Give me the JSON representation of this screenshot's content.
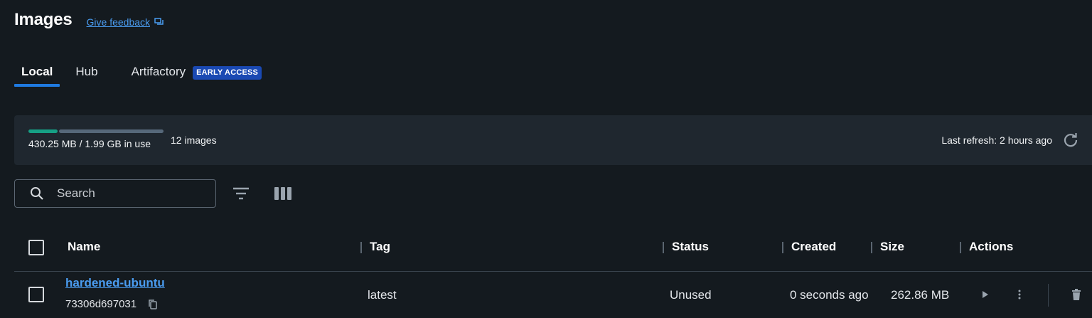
{
  "header": {
    "title": "Images",
    "feedback_label": "Give feedback"
  },
  "tabs": [
    {
      "label": "Local",
      "active": true
    },
    {
      "label": "Hub",
      "active": false
    },
    {
      "label": "Artifactory",
      "active": false,
      "badge": "EARLY ACCESS"
    }
  ],
  "usage": {
    "used_text": "430.25 MB / 1.99 GB in use",
    "images_count": "12 images",
    "last_refresh": "Last refresh: 2 hours ago",
    "used_fraction": 0.21,
    "used_color": "#16a085",
    "free_color": "#56687a"
  },
  "search": {
    "placeholder": "Search",
    "value": ""
  },
  "table": {
    "columns": [
      "Name",
      "Tag",
      "Status",
      "Created",
      "Size",
      "Actions"
    ],
    "rows": [
      {
        "name": "hardened-ubuntu",
        "id": "73306d697031",
        "tag": "latest",
        "status": "Unused",
        "created": "0 seconds ago",
        "size": "262.86 MB"
      }
    ]
  },
  "icons": {
    "feedback": "feedback-icon",
    "refresh": "refresh-icon",
    "search": "search-icon",
    "filter": "filter-icon",
    "columns": "columns-icon",
    "copy": "copy-icon",
    "run": "play-icon",
    "more": "more-vertical-icon",
    "delete": "trash-icon"
  },
  "colors": {
    "accent": "#1f7ae0",
    "link": "#4a9cf0",
    "badge_bg": "#1a49b3",
    "background": "#141a1f",
    "panel": "#1f272f"
  }
}
